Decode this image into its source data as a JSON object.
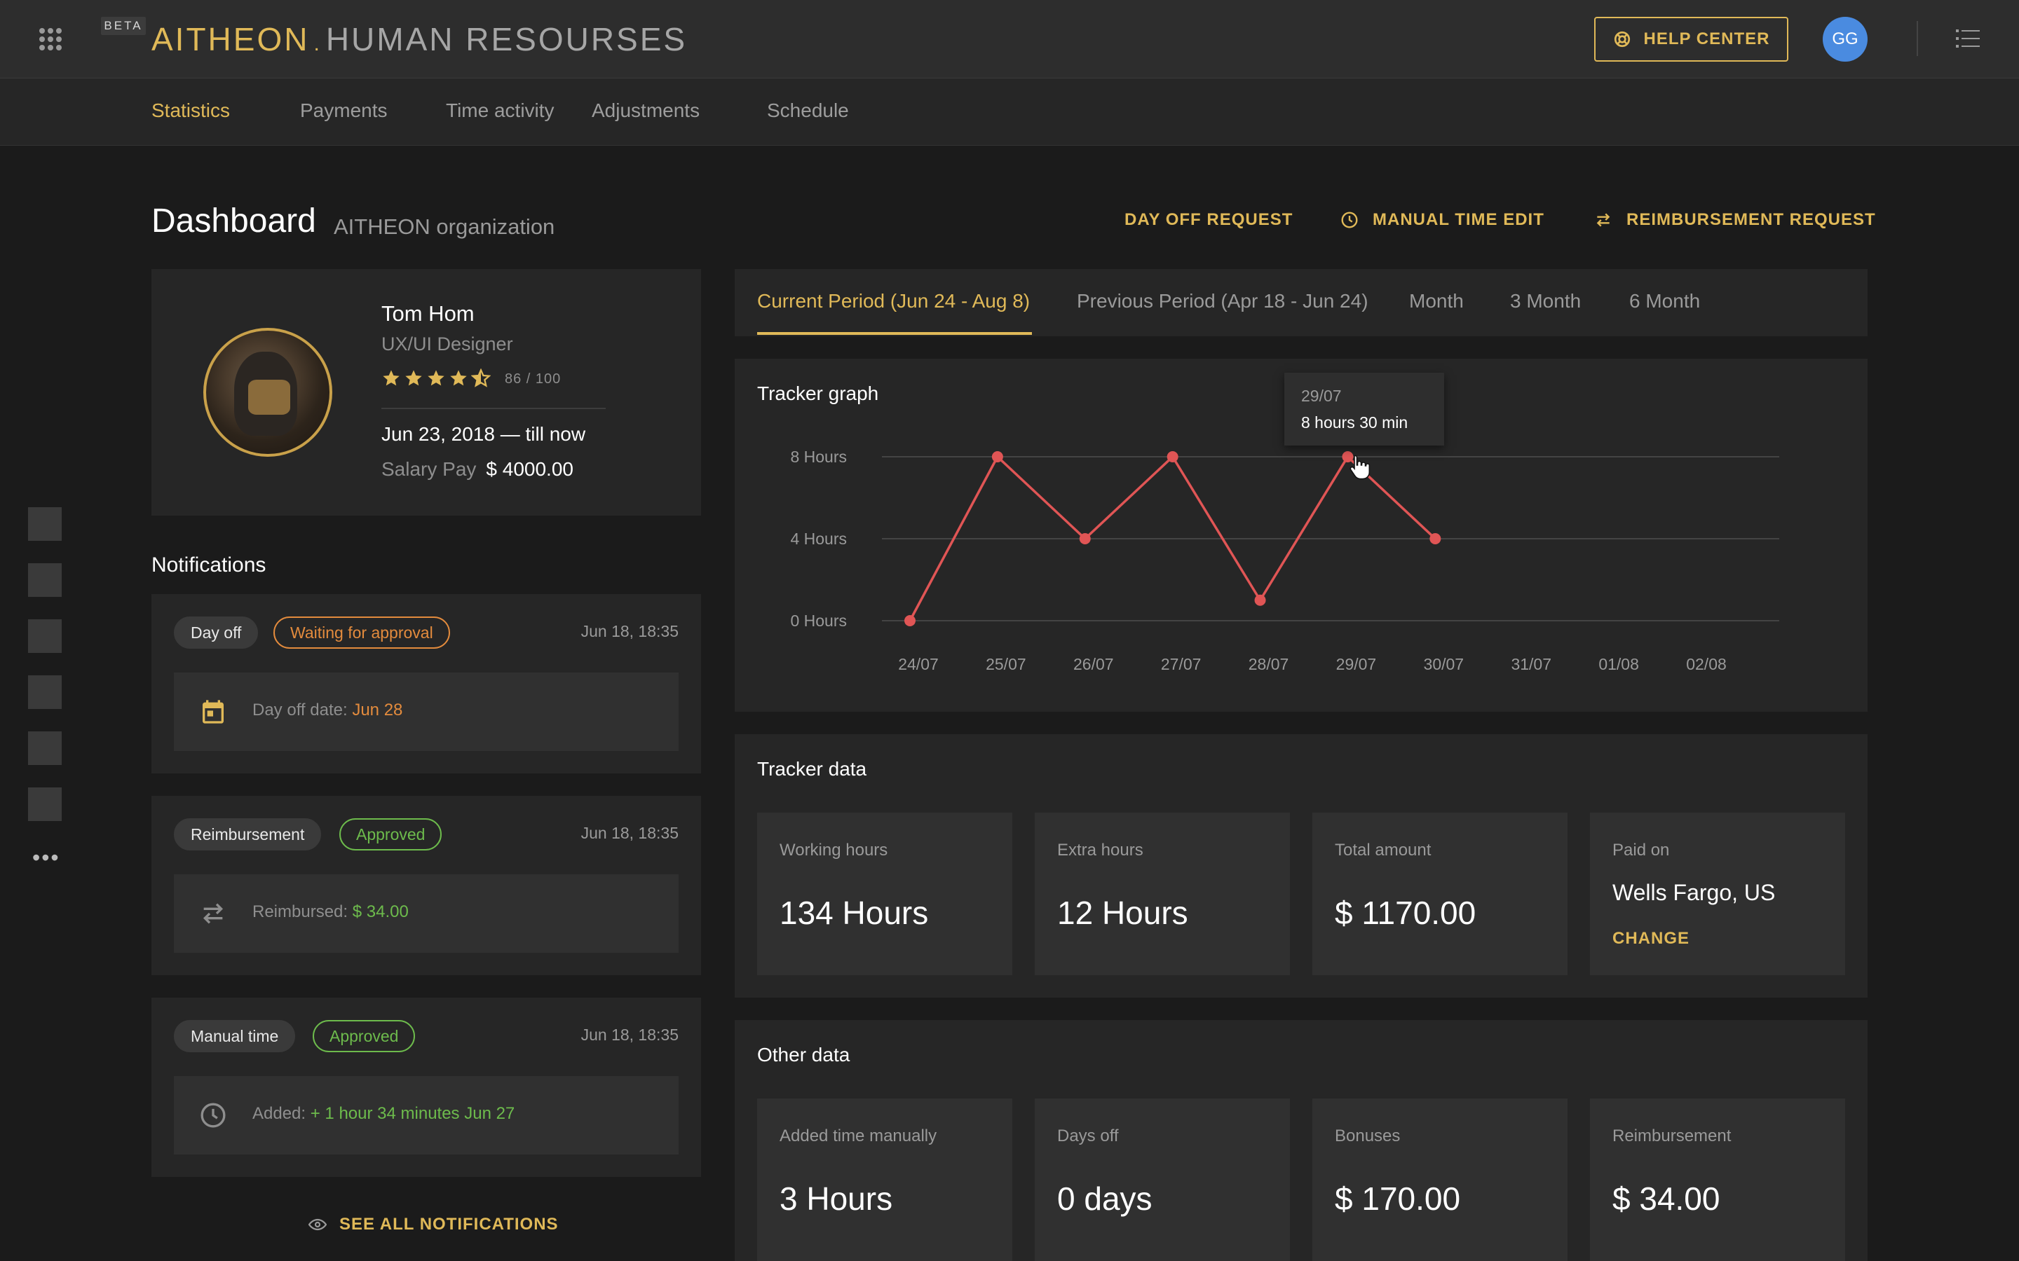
{
  "header": {
    "beta_label": "BETA",
    "brand": "AITHEON",
    "separator": ".",
    "module": "HUMAN RESOURSES",
    "help_label": "HELP CENTER",
    "avatar_initials": "GG"
  },
  "nav": {
    "items": [
      "Statistics",
      "Payments",
      "Time activity",
      "Adjustments",
      "Schedule"
    ],
    "active": "Statistics"
  },
  "page": {
    "title": "Dashboard",
    "subtitle": "AITHEON organization",
    "actions": {
      "day_off": "DAY OFF REQUEST",
      "manual_time": "MANUAL TIME EDIT",
      "reimbursement": "REIMBURSEMENT REQUEST"
    }
  },
  "profile": {
    "name": "Tom Hom",
    "role": "UX/UI Designer",
    "rating": 4.5,
    "score": "86 / 100",
    "since": "Jun 23, 2018 — till now",
    "salary_label": "Salary Pay",
    "salary_value": "$ 4000.00"
  },
  "notifications": {
    "title": "Notifications",
    "items": [
      {
        "type": "Day off",
        "status": "Waiting for approval",
        "date": "Jun 18, 18:35",
        "detail_label": "Day off date:",
        "detail_value": "Jun 28"
      },
      {
        "type": "Reimbursement",
        "status": "Approved",
        "date": "Jun 18, 18:35",
        "detail_label": "Reimbursed:",
        "detail_value": "$ 34.00"
      },
      {
        "type": "Manual time",
        "status": "Approved",
        "date": "Jun 18, 18:35",
        "detail_label": "Added:",
        "detail_value": "+ 1 hour 34 minutes Jun 27"
      }
    ],
    "see_all": "SEE ALL NOTIFICATIONS"
  },
  "period_tabs": {
    "items": [
      "Current Period (Jun 24 - Aug 8)",
      "Previous Period (Apr 18 - Jun 24)",
      "Month",
      "3 Month",
      "6 Month"
    ],
    "active": "Current Period (Jun 24 - Aug 8)"
  },
  "tracker_graph": {
    "title": "Tracker graph",
    "tooltip": {
      "date": "29/07",
      "value": "8 hours 30 min"
    }
  },
  "chart_data": {
    "type": "line",
    "title": "Tracker graph",
    "x": [
      "24/07",
      "25/07",
      "26/07",
      "27/07",
      "28/07",
      "29/07",
      "30/07",
      "31/07",
      "01/08",
      "02/08"
    ],
    "y_ticks": [
      "8  Hours",
      "4 Hours",
      "0 Hours"
    ],
    "ylim": [
      0,
      8
    ],
    "series": [
      {
        "values": [
          0,
          8,
          4,
          8,
          1,
          8,
          4
        ],
        "color": "#e05555"
      }
    ],
    "grid": true
  },
  "tracker_data": {
    "title": "Tracker data",
    "stats": [
      {
        "label": "Working hours",
        "value": "134 Hours"
      },
      {
        "label": "Extra hours",
        "value": "12 Hours"
      },
      {
        "label": "Total amount",
        "value": "$ 1170.00"
      },
      {
        "label": "Paid on",
        "value": "Wells Fargo, US",
        "action": "CHANGE"
      }
    ]
  },
  "other_data": {
    "title": "Other data",
    "stats": [
      {
        "label": "Added time manually",
        "value": "3 Hours"
      },
      {
        "label": "Days off",
        "value": "0 days"
      },
      {
        "label": "Bonuses",
        "value": "$ 170.00"
      },
      {
        "label": "Reimbursement",
        "value": "$ 34.00"
      }
    ]
  },
  "colors": {
    "accent": "#e0b958",
    "orange": "#e38b3d",
    "green": "#6dbb4c",
    "line": "#e05555",
    "avatar": "#4a8be0"
  }
}
